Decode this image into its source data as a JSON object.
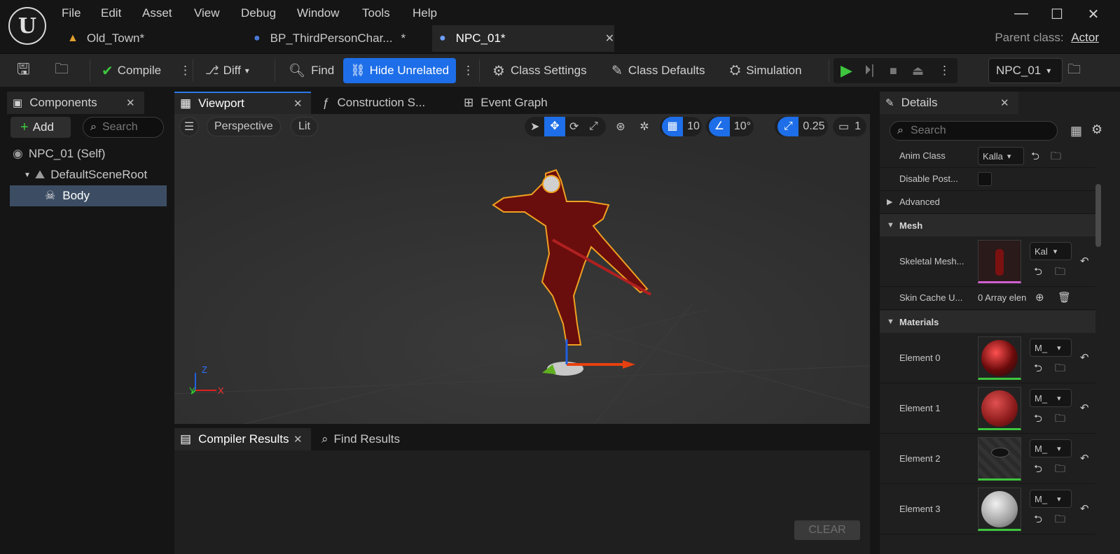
{
  "menu": [
    "File",
    "Edit",
    "Asset",
    "View",
    "Debug",
    "Window",
    "Tools",
    "Help"
  ],
  "window_controls": {
    "minimize": "—",
    "maximize": "☐",
    "close": "✕"
  },
  "tabs": [
    {
      "label": "Old_Town*"
    },
    {
      "label": "BP_ThirdPersonChar...",
      "modified": "*"
    },
    {
      "label": "NPC_01*"
    }
  ],
  "parent_class": {
    "label": "Parent class:",
    "value": "Actor"
  },
  "toolbar": {
    "compile": "Compile",
    "diff": "Diff",
    "find": "Find",
    "hide_unrelated": "Hide Unrelated",
    "class_settings": "Class Settings",
    "class_defaults": "Class Defaults",
    "simulation": "Simulation",
    "debug_object": "NPC_01"
  },
  "components": {
    "title": "Components",
    "add_label": "Add",
    "search_placeholder": "Search",
    "items": [
      {
        "label": "NPC_01 (Self)"
      },
      {
        "label": "DefaultSceneRoot"
      },
      {
        "label": "Body"
      }
    ]
  },
  "viewport_tabs": [
    {
      "label": "Viewport"
    },
    {
      "label": "Construction S..."
    },
    {
      "label": "Event Graph"
    }
  ],
  "viewport": {
    "perspective": "Perspective",
    "lit": "Lit",
    "grid_snap": "10",
    "rotation_snap": "10°",
    "scale_snap": "0.25",
    "camera_speed": "1",
    "axis_x": "X",
    "axis_y": "Y",
    "axis_z": "Z"
  },
  "bottom_tabs": [
    {
      "label": "Compiler Results"
    },
    {
      "label": "Find Results"
    }
  ],
  "clear_label": "CLEAR",
  "details": {
    "title": "Details",
    "search_placeholder": "Search",
    "anim_class": {
      "label": "Anim Class",
      "value": "Kalla"
    },
    "disable_post": {
      "label": "Disable Post..."
    },
    "advanced": "Advanced",
    "mesh_category": "Mesh",
    "skeletal_mesh": {
      "label": "Skeletal Mesh...",
      "value": "Kal"
    },
    "skin_cache": {
      "label": "Skin Cache U...",
      "value": "0 Array elen"
    },
    "materials_category": "Materials",
    "elements": [
      {
        "label": "Element 0",
        "value": "M_",
        "color": "#7a1010"
      },
      {
        "label": "Element 1",
        "value": "M_",
        "color": "#9a2a2a"
      },
      {
        "label": "Element 2",
        "value": "M_",
        "color": "#2a2a2a"
      },
      {
        "label": "Element 3",
        "value": "M_",
        "color": "#bcbcbc"
      }
    ]
  },
  "colors": {
    "accent": "#1d6ee8",
    "selection_outline": "#f0a020",
    "play": "#3ec63e"
  }
}
